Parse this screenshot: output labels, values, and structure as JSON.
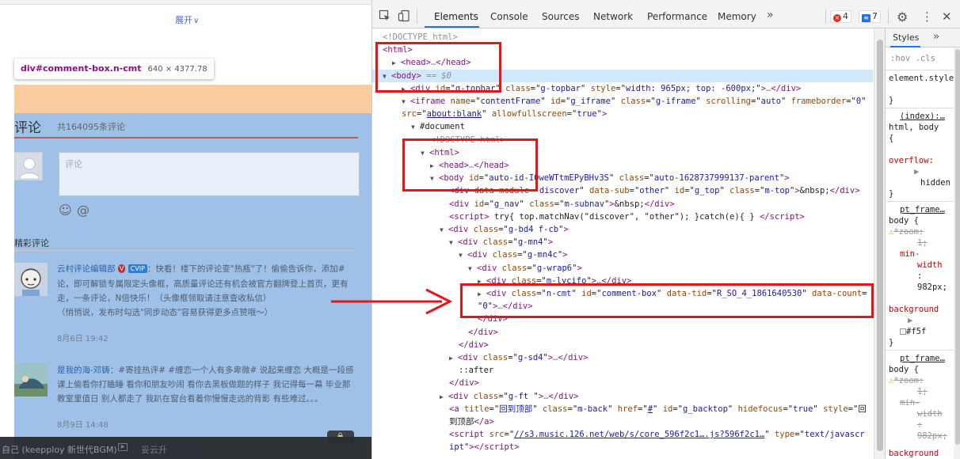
{
  "page": {
    "expand_label": "展开",
    "tooltip": {
      "selector": "div#comment-box.n-cmt",
      "size": "640 × 4377.78"
    },
    "comments": {
      "title": "评论",
      "count": "共164095条评论",
      "input_placeholder": "评论",
      "hot_label": "精彩评论",
      "items": [
        {
          "user": "云村评论编辑部",
          "lines": [
            "：快看！楼下的评论变\"热瓶\"了！偷偷告诉你，添加#",
            "论，即可解锁专属限定头像框，高质量评论还有机会被官方翻牌登上首页，更有",
            "走，一条评论，N倍快乐！（头像框领取请注意查收私信）",
            "（悄悄说，发布时勾选\"同步动态\"容易获得更多点赞哦～）"
          ],
          "time": "8月6日 19:42"
        },
        {
          "user": "是我的海-邓铸",
          "lines": [
            "：#寄挂热评# #缠恋一个人有多卑微# 说起来缠恋 大概是一段感",
            "课上偷看你打瞌睡 看你和朋友吵闹 看你去黑板做题的样子 我记得每一幕 毕业那",
            "教室里值日 别人都走了 我趴在窗台看着你慢慢走远的背影 有些难过。。。"
          ],
          "time": "8月9日 14:48"
        }
      ]
    },
    "player": {
      "song": "自己 (keepploy 新世代BGM)",
      "collect": "妥云升"
    }
  },
  "devtools": {
    "tabs": [
      "Elements",
      "Console",
      "Sources",
      "Network",
      "Performance",
      "Memory"
    ],
    "more_tabs": "»",
    "errors": "4",
    "messages": "7",
    "dom_lines": [
      {
        "indent": 0,
        "kind": "doctype",
        "text": "<!DOCTYPE html>"
      },
      {
        "indent": 0,
        "kind": "tag",
        "html": "<span class='tg'>&lt;html&gt;</span>"
      },
      {
        "indent": 1,
        "kind": "tag",
        "html": "<span class='tri'>▶</span><span class='tg'>&lt;head&gt;</span><span class='dots'>…</span><span class='tg'>&lt;/head&gt;</span>"
      },
      {
        "indent": 0,
        "kind": "tag",
        "html": "<span class='tri'>▼</span><span class='tg'>&lt;body&gt;</span> <span class='eqd'>== $0</span>"
      },
      {
        "indent": 2,
        "kind": "tag",
        "html": "<span class='tri'>▶</span><span class='tg'>&lt;div </span><span class='an'>id</span>=\"<span class='av'>g-topbar</span>\" <span class='an'>class</span>=\"<span class='av'>g-topbar</span>\" <span class='an'>style</span>=\"<span class='av'>width: 965px; top: -600px;</span>\"<span class='tg'>&gt;</span><span class='dots'>…</span><span class='tg'>&lt;/div&gt;</span>"
      },
      {
        "indent": 2,
        "kind": "tag",
        "html": "<span class='tri'>▼</span><span class='tg'>&lt;iframe </span><span class='an'>name</span>=\"<span class='av'>contentFrame</span>\" <span class='an'>id</span>=\"<span class='av'>g_iframe</span>\" <span class='an'>class</span>=\"<span class='av'>g-iframe</span>\" <span class='an'>scrolling</span>=\"<span class='av'>auto</span>\" <span class='an'>frameborder</span>=\"<span class='av'>0</span>\""
      },
      {
        "indent": 2,
        "kind": "tag",
        "html": "<span class='an'>src</span>=\"<span class='lk'>about:blank</span>\" <span class='an'>allowfullscreen</span>=\"<span class='av'>true</span>\"<span class='tg'>&gt;</span>"
      },
      {
        "indent": 3,
        "kind": "tag",
        "html": "<span class='tri'>▼</span><span class='pl'>#document</span>"
      },
      {
        "indent": 5,
        "kind": "doctype",
        "text": "<!DOCTYPE html>"
      },
      {
        "indent": 4,
        "kind": "tag",
        "html": "<span class='tri'>▼</span><span class='tg'>&lt;html&gt;</span>"
      },
      {
        "indent": 5,
        "kind": "tag",
        "html": "<span class='tri'>▶</span><span class='tg'>&lt;head&gt;</span><span class='dots'>…</span><span class='tg'>&lt;/head&gt;</span>"
      },
      {
        "indent": 5,
        "kind": "tag",
        "html": "<span class='tri'>▼</span><span class='tg'>&lt;body </span><span class='an'>id</span>=\"<span class='av'>auto-id-IOweWTtmEPyBHv3S</span>\" <span class='an'>class</span>=\"<span class='av'>auto-1628737999137-parent</span>\"<span class='tg'>&gt;</span>"
      },
      {
        "indent": 7,
        "kind": "tag",
        "html": "<span class='tg'>&lt;div </span><span class='an'>data-module</span>=\"<span class='av'>discover</span>\" <span class='an'>data-sub</span>=\"<span class='av'>other</span>\" <span class='an'>id</span>=\"<span class='av'>g_top</span>\" <span class='an'>class</span>=\"<span class='av'>m-top</span>\"<span class='tg'>&gt;</span>&amp;nbsp;<span class='tg'>&lt;/div&gt;</span>"
      },
      {
        "indent": 7,
        "kind": "tag",
        "html": "<span class='tg'>&lt;div </span><span class='an'>id</span>=\"<span class='av'>g_nav</span>\" <span class='an'>class</span>=\"<span class='av'>m-subnav</span>\"<span class='tg'>&gt;</span>&amp;nbsp;<span class='tg'>&lt;/div&gt;</span>"
      },
      {
        "indent": 7,
        "kind": "tag",
        "html": "<span class='tg'>&lt;script&gt;</span> try{ top.matchNav(\"discover\", \"other\"); }catch(e){ } <span class='tg'>&lt;/script&gt;</span>"
      },
      {
        "indent": 6,
        "kind": "tag",
        "html": "<span class='tri'>▼</span><span class='tg'>&lt;div </span><span class='an'>class</span>=\"<span class='av'>g-bd4 f-cb</span>\"<span class='tg'>&gt;</span>"
      },
      {
        "indent": 7,
        "kind": "tag",
        "html": "<span class='tri'>▼</span><span class='tg'>&lt;div </span><span class='an'>class</span>=\"<span class='av'>g-mn4</span>\"<span class='tg'>&gt;</span>"
      },
      {
        "indent": 8,
        "kind": "tag",
        "html": "<span class='tri'>▼</span><span class='tg'>&lt;div </span><span class='an'>class</span>=\"<span class='av'>g-mn4c</span>\"<span class='tg'>&gt;</span>"
      },
      {
        "indent": 9,
        "kind": "tag",
        "html": "<span class='tri'>▼</span><span class='tg'>&lt;div </span><span class='an'>class</span>=\"<span class='av'>g-wrap6</span>\"<span class='tg'>&gt;</span>"
      },
      {
        "indent": 10,
        "kind": "tag",
        "html": "<span class='tri'>▶</span><span class='tg'>&lt;div </span><span class='an'>class</span>=\"<span class='av'>m-lycifo</span>\"<span class='tg'>&gt;</span><span class='dots'>…</span><span class='tg'>&lt;/div&gt;</span>"
      },
      {
        "indent": 10,
        "kind": "tag",
        "html": "<span class='tri'>▶</span><span class='tg'>&lt;div </span><span class='an'>class</span>=\"<span class='av'>n-cmt</span>\" <span class='an'>id</span>=\"<span class='av'>comment-box</span>\" <span class='an'>data-tid</span>=\"<span class='av'>R_SO_4_1861640530</span>\" <span class='an'>data-count</span>="
      },
      {
        "indent": 10,
        "kind": "tag",
        "html": "\"<span class='av'>0</span>\"<span class='tg'>&gt;</span><span class='dots'>…</span><span class='tg'>&lt;/div&gt;</span>"
      },
      {
        "indent": 10,
        "kind": "tag",
        "html": "<span class='tg'>&lt;/div&gt;</span>"
      },
      {
        "indent": 9,
        "kind": "tag",
        "html": "<span class='tg'>&lt;/div&gt;</span>"
      },
      {
        "indent": 8,
        "kind": "tag",
        "html": "<span class='tg'>&lt;/div&gt;</span>"
      },
      {
        "indent": 7,
        "kind": "tag",
        "html": "<span class='tri'>▶</span><span class='tg'>&lt;div </span><span class='an'>class</span>=\"<span class='av'>g-sd4</span>\"<span class='tg'>&gt;</span><span class='dots'>…</span><span class='tg'>&lt;/div&gt;</span>"
      },
      {
        "indent": 8,
        "kind": "tag",
        "html": "<span class='pl'>::after</span>"
      },
      {
        "indent": 7,
        "kind": "tag",
        "html": "<span class='tg'>&lt;/div&gt;</span>"
      },
      {
        "indent": 6,
        "kind": "tag",
        "html": "<span class='tri'>▶</span><span class='tg'>&lt;div </span><span class='an'>class</span>=\"<span class='av'>g-ft </span>\"<span class='tg'>&gt;</span><span class='dots'>…</span><span class='tg'>&lt;/div&gt;</span>"
      },
      {
        "indent": 7,
        "kind": "tag",
        "html": "<span class='tg'>&lt;a </span><span class='an'>title</span>=\"<span class='av'>回到顶部</span>\" <span class='an'>class</span>=\"<span class='av'>m-back</span>\" <span class='an'>href</span>=\"<span class='lk'>#</span>\" <span class='an'>id</span>=\"<span class='av'>g_backtop</span>\" <span class='an'>hidefocus</span>=\"<span class='av'>true</span>\" <span class='an'>style</span>=\"<span class='pl'>回</span>"
      },
      {
        "indent": 7,
        "kind": "tag",
        "html": "<span class='pl'>到顶部</span><span class='tg'>&lt;/a&gt;</span>"
      },
      {
        "indent": 7,
        "kind": "tag",
        "html": "<span class='tg'>&lt;script </span><span class='an'>src</span>=\"<span class='lk'>//s3.music.126.net/web/s/core_596f2c1….js?596f2c1…</span>\" <span class='an'>type</span>=\"<span class='av'>text/javascr</span>"
      },
      {
        "indent": 7,
        "kind": "tag",
        "html": "<span class='av'>ipt</span>\"<span class='tg'>&gt;&lt;/script&gt;</span>"
      }
    ],
    "styles_pane": {
      "tab": "Styles",
      "more": "»",
      "filter": ":hov .cls",
      "element_style": "element.style {",
      "element_style_close": "}",
      "rule1_source": "(index):…",
      "rule1_selector": "html, body",
      "rule1_open": "{",
      "rule1_prop": "overflow:",
      "rule1_val": "hidden",
      "rule1_close": "}",
      "rule2_source": "pt_frame…",
      "rule2_selector": "body {",
      "rule2_zoom": "*zoom:",
      "rule2_zoom_val": "1;",
      "rule2_minw": "min-",
      "rule2_minw2": "width",
      "rule2_minw3": ":",
      "rule2_minw_val": "982px;",
      "rule2_bg": "background",
      "rule2_bg_val": "#f5f",
      "rule2_close": "}",
      "rule3_source": "pt_frame…",
      "rule3_selector": "body {",
      "rule3_zoom": "*zoom:",
      "rule3_zoom_val": "1;",
      "rule3_minw": "min-",
      "rule3_minw2": "width",
      "rule3_minw3": ":",
      "rule3_minw_val": "982px;",
      "rule3_bg": "background"
    }
  },
  "colors": {
    "highlight_content": "#9fc1e8",
    "highlight_margin": "#f9cc9d",
    "annotation_red": "#e3161b",
    "accent_blue": "#1a73e8"
  }
}
